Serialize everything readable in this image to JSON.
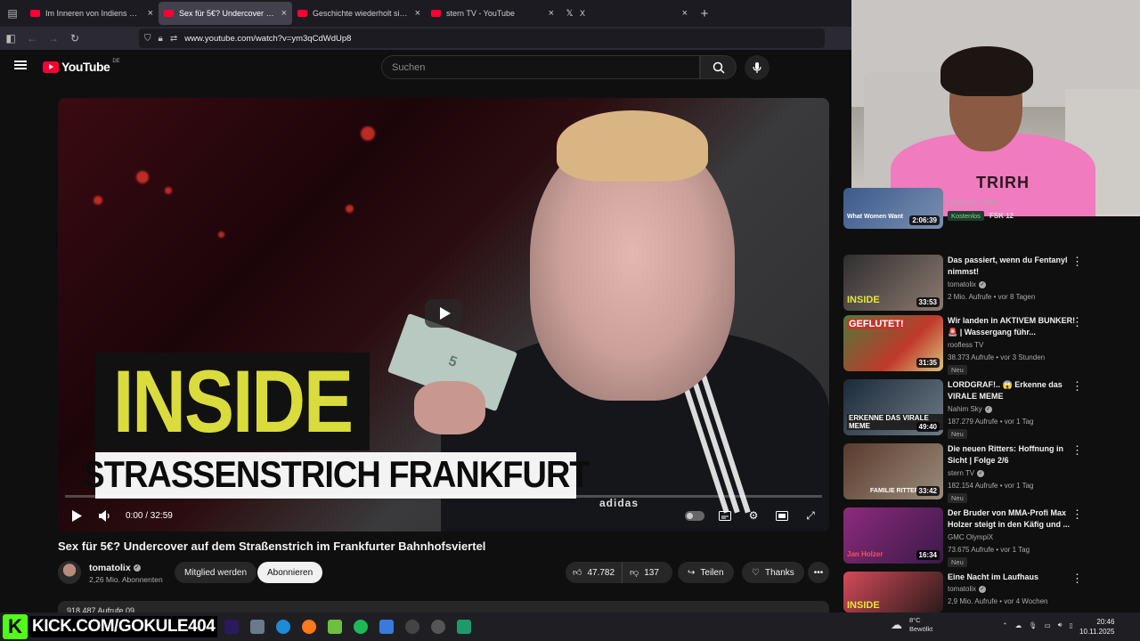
{
  "browser": {
    "tabs": [
      {
        "title": "Im Inneren von Indiens Poop-Wasser",
        "active": false
      },
      {
        "title": "Sex für 5€? Undercover auf dem Straßenstrich",
        "active": true
      },
      {
        "title": "Geschichte wiederholt sich - Fake",
        "active": false
      },
      {
        "title": "stern TV - YouTube",
        "active": false
      },
      {
        "title": "X",
        "active": false
      }
    ],
    "url": "www.youtube.com/watch?v=ym3qCdWdUp8"
  },
  "youtube": {
    "logo_text": "YouTube",
    "logo_region": "DE",
    "search_placeholder": "Suchen"
  },
  "player": {
    "thumb_line1": "INSIDE",
    "thumb_line2": "STRASSENSTRICH FRANKFURT",
    "bill_text": "5",
    "brand_text": "adidas",
    "time": "0:00 / 32:59",
    "progress_fraction": 0.0
  },
  "video": {
    "title": "Sex für 5€? Undercover auf dem Straßenstrich im Frankfurter Bahnhofsviertel",
    "channel": "tomatolix",
    "subscribers": "2,26 Mio. Abonnenten",
    "member_label": "Mitglied werden",
    "subscribe_label": "Abonnieren",
    "likes": "47.782",
    "dislikes": "137",
    "share_label": "Teilen",
    "thanks_label": "Thanks",
    "more_label": "•••",
    "views_partial": "918.487 Aufrufe  09"
  },
  "recommendations": [
    {
      "title": "",
      "channel": "",
      "meta": "Komödie • 2000",
      "badge1": "Kostenlos",
      "badge2": "FSK 12",
      "duration": "2:06:39",
      "thumb_text": "What Women Want"
    },
    {
      "title": "Das passiert, wenn du Fentanyl nimmst!",
      "channel": "tomatolix",
      "meta": "2 Mio. Aufrufe • vor 8 Tagen",
      "badge": "",
      "duration": "33:53",
      "thumb_text": "INSIDE"
    },
    {
      "title": "Wir landen in AKTIVEM BUNKER! 🚨 | Wassergang führ...",
      "channel": "roofless TV",
      "meta": "38.373 Aufrufe • vor 3 Stunden",
      "badge": "Neu",
      "duration": "31:35",
      "thumb_text": "GEFLUTET!"
    },
    {
      "title": "LORDGRAF!.. 😱 Erkenne das VIRALE MEME",
      "channel": "Nahim Sky",
      "meta": "187.279 Aufrufe • vor 1 Tag",
      "badge": "Neu",
      "duration": "49:40",
      "thumb_text": "ERKENNE DAS VIRALE MEME"
    },
    {
      "title": "Die neuen Ritters: Hoffnung in Sicht | Folge 2/6",
      "channel": "stern TV",
      "meta": "182.154 Aufrufe • vor 1 Tag",
      "badge": "Neu",
      "duration": "33:42",
      "thumb_text": "FAMILIE RITTER"
    },
    {
      "title": "Der Bruder von MMA-Profi Max Holzer steigt in den Käfig und ...",
      "channel": "GMC OlympiX",
      "meta": "73.675 Aufrufe • vor 1 Tag",
      "badge": "Neu",
      "duration": "16:34",
      "thumb_text": "Jan Holzer"
    },
    {
      "title": "Eine Nacht im Laufhaus",
      "channel": "tomatolix",
      "meta": "2,9 Mio. Aufrufe • vor 4 Wochen",
      "badge": "",
      "duration": "",
      "thumb_text": "INSIDE"
    }
  ],
  "webcam": {
    "shirt_text": "TRIRH"
  },
  "taskbar": {
    "kick_letter": "K",
    "kick_text": "KICK.COM/GOKULE404",
    "weather_temp": "8°C",
    "weather_text": "Bewölkt",
    "time": "20:46",
    "date": "10.11.2025"
  },
  "colors": {
    "accent": "#ff0033",
    "kick": "#53fc18",
    "thumb_yellow": "#d9dc3c"
  }
}
